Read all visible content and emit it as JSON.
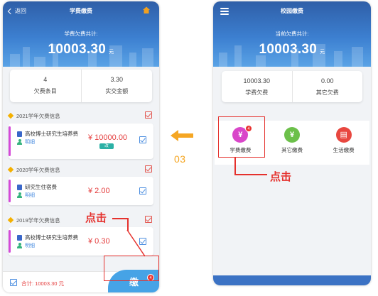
{
  "left": {
    "back_label": "返回",
    "title": "学费缴费",
    "owed_label": "学费欠费共计:",
    "owed_amount": "10003.30",
    "owed_unit": "元",
    "stats": [
      {
        "value": "4",
        "label": "欠费条目"
      },
      {
        "value": "3.30",
        "label": "实交金额"
      }
    ],
    "years": [
      {
        "title": "2021学年欠费信息",
        "item": "高校博士研究生培养费",
        "amount": "¥ 10000.00",
        "detail": "明细",
        "tag": "改"
      },
      {
        "title": "2020学年欠费信息",
        "item": "研究生住宿费",
        "amount": "¥ 2.00",
        "detail": "明细"
      },
      {
        "title": "2019学年欠费信息",
        "item": "高校博士研究生培养费",
        "amount": "¥ 0.30",
        "detail": "明细"
      }
    ],
    "footer_total": "合计: 10003.30 元",
    "pay_icon": "缴",
    "pay_badge": "4",
    "annotation": "点击"
  },
  "middle": {
    "step": "03",
    "arrow_color": "#f5a623"
  },
  "right": {
    "title": "校园缴费",
    "owed_label": "当前欠费共计:",
    "owed_amount": "10003.30",
    "owed_unit": "元",
    "stats": [
      {
        "value": "10003.30",
        "label": "学费欠费"
      },
      {
        "value": "0.00",
        "label": "其它欠费"
      }
    ],
    "services": [
      {
        "label": "学费缴费",
        "icon": "yen-icon",
        "color": "#d946c9",
        "badge": "4"
      },
      {
        "label": "其它缴费",
        "icon": "yen-icon",
        "color": "#6cc04a"
      },
      {
        "label": "生活缴费",
        "icon": "receipt-icon",
        "color": "#e8473f"
      }
    ],
    "annotation": "点击"
  },
  "colors": {
    "header_blue": "#3c7fd0",
    "highlight_red": "#e5312d",
    "amount_red": "#e43d3d",
    "link_blue": "#4c8ee0"
  }
}
